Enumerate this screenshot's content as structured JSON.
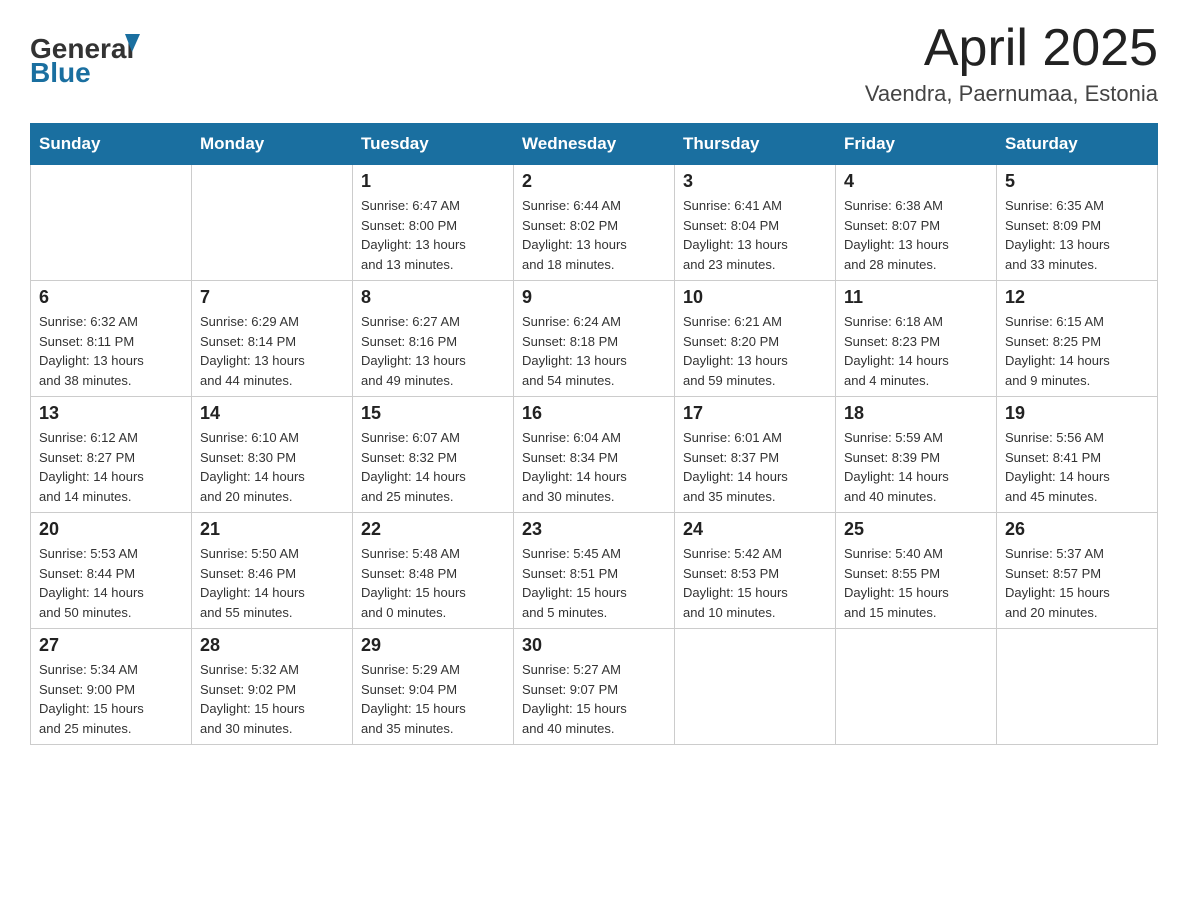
{
  "header": {
    "logo_general": "General",
    "logo_blue": "Blue",
    "month_title": "April 2025",
    "location": "Vaendra, Paernumaa, Estonia"
  },
  "weekdays": [
    "Sunday",
    "Monday",
    "Tuesday",
    "Wednesday",
    "Thursday",
    "Friday",
    "Saturday"
  ],
  "weeks": [
    [
      {
        "day": "",
        "info": ""
      },
      {
        "day": "",
        "info": ""
      },
      {
        "day": "1",
        "info": "Sunrise: 6:47 AM\nSunset: 8:00 PM\nDaylight: 13 hours\nand 13 minutes."
      },
      {
        "day": "2",
        "info": "Sunrise: 6:44 AM\nSunset: 8:02 PM\nDaylight: 13 hours\nand 18 minutes."
      },
      {
        "day": "3",
        "info": "Sunrise: 6:41 AM\nSunset: 8:04 PM\nDaylight: 13 hours\nand 23 minutes."
      },
      {
        "day": "4",
        "info": "Sunrise: 6:38 AM\nSunset: 8:07 PM\nDaylight: 13 hours\nand 28 minutes."
      },
      {
        "day": "5",
        "info": "Sunrise: 6:35 AM\nSunset: 8:09 PM\nDaylight: 13 hours\nand 33 minutes."
      }
    ],
    [
      {
        "day": "6",
        "info": "Sunrise: 6:32 AM\nSunset: 8:11 PM\nDaylight: 13 hours\nand 38 minutes."
      },
      {
        "day": "7",
        "info": "Sunrise: 6:29 AM\nSunset: 8:14 PM\nDaylight: 13 hours\nand 44 minutes."
      },
      {
        "day": "8",
        "info": "Sunrise: 6:27 AM\nSunset: 8:16 PM\nDaylight: 13 hours\nand 49 minutes."
      },
      {
        "day": "9",
        "info": "Sunrise: 6:24 AM\nSunset: 8:18 PM\nDaylight: 13 hours\nand 54 minutes."
      },
      {
        "day": "10",
        "info": "Sunrise: 6:21 AM\nSunset: 8:20 PM\nDaylight: 13 hours\nand 59 minutes."
      },
      {
        "day": "11",
        "info": "Sunrise: 6:18 AM\nSunset: 8:23 PM\nDaylight: 14 hours\nand 4 minutes."
      },
      {
        "day": "12",
        "info": "Sunrise: 6:15 AM\nSunset: 8:25 PM\nDaylight: 14 hours\nand 9 minutes."
      }
    ],
    [
      {
        "day": "13",
        "info": "Sunrise: 6:12 AM\nSunset: 8:27 PM\nDaylight: 14 hours\nand 14 minutes."
      },
      {
        "day": "14",
        "info": "Sunrise: 6:10 AM\nSunset: 8:30 PM\nDaylight: 14 hours\nand 20 minutes."
      },
      {
        "day": "15",
        "info": "Sunrise: 6:07 AM\nSunset: 8:32 PM\nDaylight: 14 hours\nand 25 minutes."
      },
      {
        "day": "16",
        "info": "Sunrise: 6:04 AM\nSunset: 8:34 PM\nDaylight: 14 hours\nand 30 minutes."
      },
      {
        "day": "17",
        "info": "Sunrise: 6:01 AM\nSunset: 8:37 PM\nDaylight: 14 hours\nand 35 minutes."
      },
      {
        "day": "18",
        "info": "Sunrise: 5:59 AM\nSunset: 8:39 PM\nDaylight: 14 hours\nand 40 minutes."
      },
      {
        "day": "19",
        "info": "Sunrise: 5:56 AM\nSunset: 8:41 PM\nDaylight: 14 hours\nand 45 minutes."
      }
    ],
    [
      {
        "day": "20",
        "info": "Sunrise: 5:53 AM\nSunset: 8:44 PM\nDaylight: 14 hours\nand 50 minutes."
      },
      {
        "day": "21",
        "info": "Sunrise: 5:50 AM\nSunset: 8:46 PM\nDaylight: 14 hours\nand 55 minutes."
      },
      {
        "day": "22",
        "info": "Sunrise: 5:48 AM\nSunset: 8:48 PM\nDaylight: 15 hours\nand 0 minutes."
      },
      {
        "day": "23",
        "info": "Sunrise: 5:45 AM\nSunset: 8:51 PM\nDaylight: 15 hours\nand 5 minutes."
      },
      {
        "day": "24",
        "info": "Sunrise: 5:42 AM\nSunset: 8:53 PM\nDaylight: 15 hours\nand 10 minutes."
      },
      {
        "day": "25",
        "info": "Sunrise: 5:40 AM\nSunset: 8:55 PM\nDaylight: 15 hours\nand 15 minutes."
      },
      {
        "day": "26",
        "info": "Sunrise: 5:37 AM\nSunset: 8:57 PM\nDaylight: 15 hours\nand 20 minutes."
      }
    ],
    [
      {
        "day": "27",
        "info": "Sunrise: 5:34 AM\nSunset: 9:00 PM\nDaylight: 15 hours\nand 25 minutes."
      },
      {
        "day": "28",
        "info": "Sunrise: 5:32 AM\nSunset: 9:02 PM\nDaylight: 15 hours\nand 30 minutes."
      },
      {
        "day": "29",
        "info": "Sunrise: 5:29 AM\nSunset: 9:04 PM\nDaylight: 15 hours\nand 35 minutes."
      },
      {
        "day": "30",
        "info": "Sunrise: 5:27 AM\nSunset: 9:07 PM\nDaylight: 15 hours\nand 40 minutes."
      },
      {
        "day": "",
        "info": ""
      },
      {
        "day": "",
        "info": ""
      },
      {
        "day": "",
        "info": ""
      }
    ]
  ]
}
